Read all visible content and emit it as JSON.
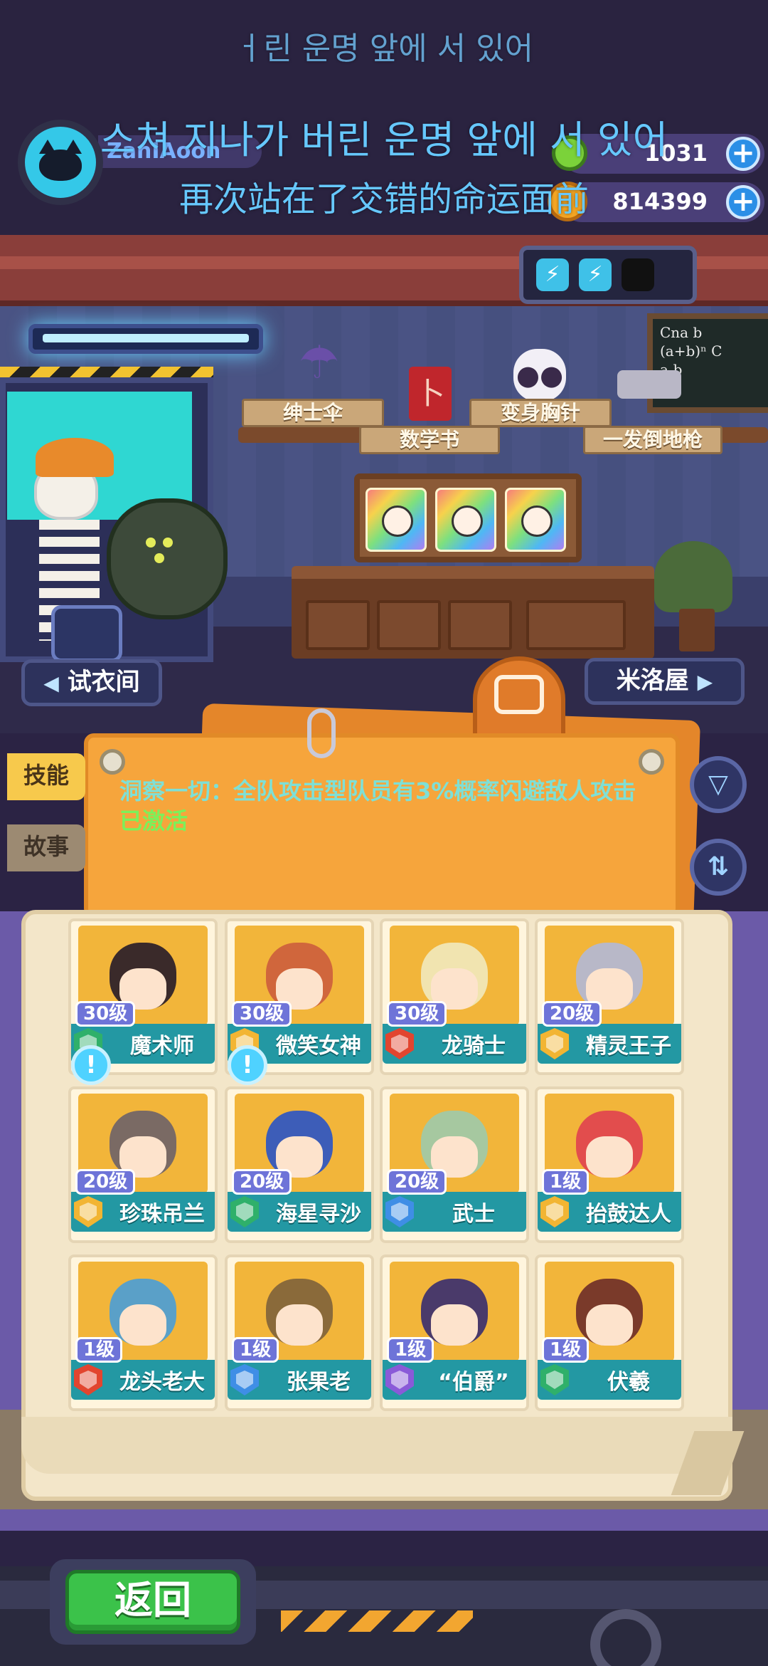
{
  "subtitles": {
    "korean_faded": "ㅓ린 운명 앞에 서 있어",
    "korean": "스쳐 지나가 버린 운명 앞에 서 있어",
    "chinese": "再次站在了交错的命运面前"
  },
  "profile": {
    "username": "ZanIAoon"
  },
  "currencies": [
    {
      "value": "1031",
      "add": "+",
      "color": "#7bd23a"
    },
    {
      "value": "814399",
      "add": "+",
      "color": "#f5a623"
    }
  ],
  "room": {
    "chalkboard": "Cna b\n(a+b)ⁿ C\na-b",
    "items": [
      {
        "label": "绅士伞",
        "icon": "umbrella-icon"
      },
      {
        "label": "数学书",
        "icon": "book-icon"
      },
      {
        "label": "变身胸针",
        "icon": "skull-brooch-icon"
      },
      {
        "label": "一发倒地枪",
        "icon": "gun-icon"
      }
    ]
  },
  "nav": {
    "fitting_room": "试衣间",
    "left_arrow": "◀",
    "right_arrow": "▶",
    "next_room": "米洛屋"
  },
  "skill": {
    "text": "洞察一切：全队攻击型队员有3%概率闪避敌人攻击",
    "status": "已激活"
  },
  "tabs": {
    "skill": "技能",
    "story": "故事"
  },
  "actions": {
    "filter": "▽",
    "sort": "⇅",
    "notification": "!"
  },
  "characters": [
    {
      "name": "魔术师",
      "level": "30级",
      "badge_color": "#2fb06a",
      "hair": "#3a2a2a"
    },
    {
      "name": "微笑女神",
      "level": "30级",
      "badge_color": "#f2b533",
      "hair": "#d0663c"
    },
    {
      "name": "龙骑士",
      "level": "30级",
      "badge_color": "#e2452f",
      "hair": "#f1e4b0"
    },
    {
      "name": "精灵王子",
      "level": "20级",
      "badge_color": "#f2b533",
      "hair": "#b8b8c8"
    },
    {
      "name": "珍珠吊兰",
      "level": "20级",
      "badge_color": "#f2b533",
      "hair": "#7a6a64"
    },
    {
      "name": "海星寻沙",
      "level": "20级",
      "badge_color": "#2fb06a",
      "hair": "#3d5db8"
    },
    {
      "name": "武士",
      "level": "20级",
      "badge_color": "#3f8ee6",
      "hair": "#a6c8a0"
    },
    {
      "name": "抬鼓达人",
      "level": "1级",
      "badge_color": "#f2b533",
      "hair": "#e24d4d"
    },
    {
      "name": "龙头老大",
      "level": "1级",
      "badge_color": "#e2452f",
      "hair": "#5aa0c8"
    },
    {
      "name": "张果老",
      "level": "1级",
      "badge_color": "#3f8ee6",
      "hair": "#8a6a3a"
    },
    {
      "name": "“伯爵”",
      "level": "1级",
      "badge_color": "#8a5ad8",
      "hair": "#4a3a6a"
    },
    {
      "name": "伏羲",
      "level": "1级",
      "badge_color": "#2fb06a",
      "hair": "#7a3a2a"
    }
  ],
  "footer_hint": "",
  "back_button": "返回"
}
